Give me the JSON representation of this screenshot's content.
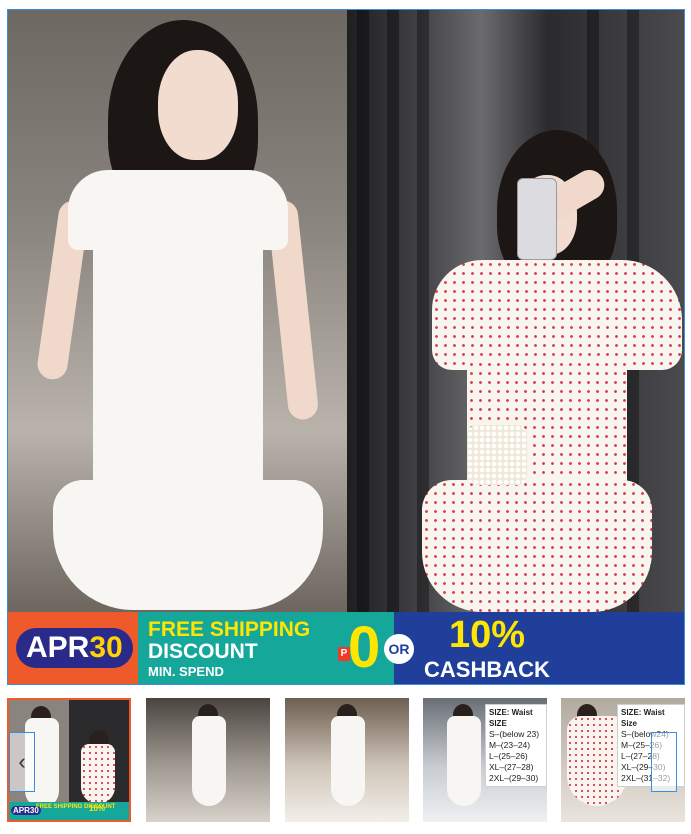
{
  "promo_banner": {
    "apr_text": "APR",
    "apr_num": "30",
    "free_line1": "FREE SHIPPING",
    "free_line2": "DISCOUNT",
    "free_line3": "MIN. SPEND",
    "peso_symbol": "P",
    "zero_value": "0",
    "or_text": "OR",
    "percent_value": "10%",
    "cashback_text": "CASHBACK",
    "colors": {
      "apr_bg": "#ef5a2a",
      "free_bg": "#16a79b",
      "cashback_bg": "#1f3f9a",
      "yellow": "#ffe600"
    }
  },
  "size_chart_1": {
    "header": "SIZE:  Waist SIZE",
    "rows": [
      "S–(below 23)",
      "M–(23–24)",
      "L–(25–26)",
      "XL–(27–28)",
      "2XL–(29–30)"
    ]
  },
  "size_chart_2": {
    "header": "SIZE: Waist Size",
    "rows": [
      "S–(below24)",
      "M–(25–26)",
      "L–(27–28)",
      "XL–(29–30)",
      "2XL–(31–32)"
    ]
  },
  "mini_banner": {
    "apr": "APR30",
    "free": "FREE SHIPPING DISCOUNT",
    "cash": "10%"
  },
  "nav": {
    "prev_icon": "chevron-left-icon",
    "next_icon": "chevron-right-icon",
    "prev_glyph": "‹"
  }
}
